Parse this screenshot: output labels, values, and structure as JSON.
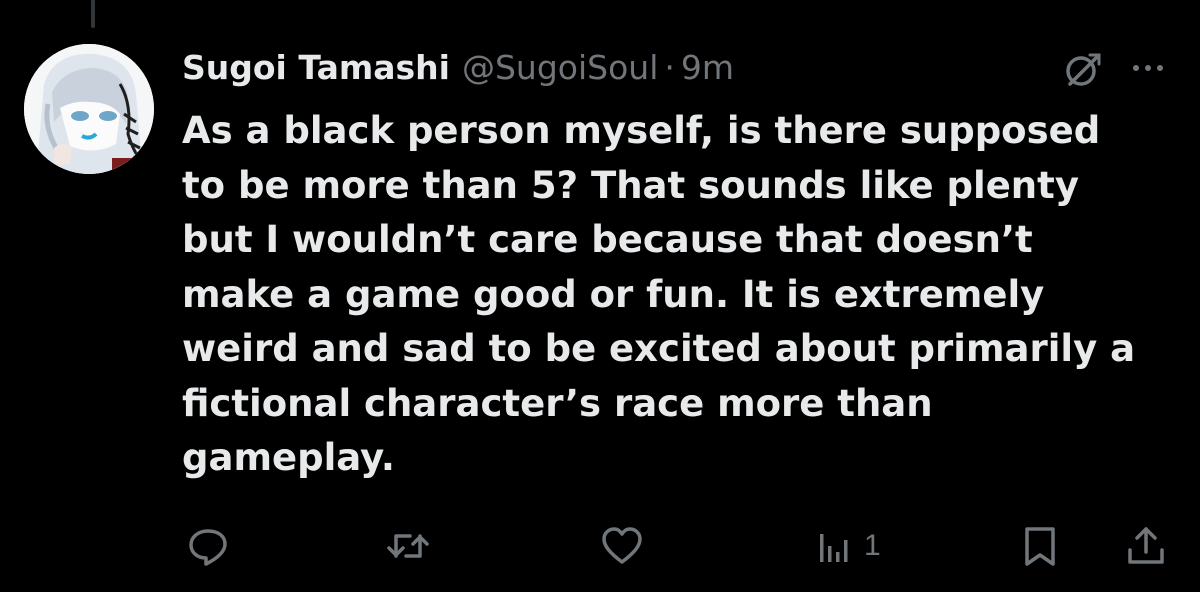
{
  "tweet": {
    "author": {
      "display_name": "Sugoi Tamashi",
      "handle": "@SugoiSoul",
      "avatar_icon": "anime-avatar"
    },
    "separator": "·",
    "timestamp": "9m",
    "text_lines": [
      "As a black person myself, is there supposed",
      "to be more than 5? That sounds like plenty",
      "but I wouldn’t care because that doesn’t",
      "make a game good or fun. It is extremely",
      "weird and sad to be excited about primarily a",
      "fictional character’s race more than",
      "gameplay."
    ],
    "header_icons": [
      "grok-icon",
      "more-icon"
    ],
    "actions": {
      "reply": {
        "icon": "reply-icon"
      },
      "retweet": {
        "icon": "retweet-icon"
      },
      "like": {
        "icon": "like-icon"
      },
      "views": {
        "icon": "views-icon",
        "count": "1"
      },
      "bookmark": {
        "icon": "bookmark-icon"
      },
      "share": {
        "icon": "share-icon"
      }
    }
  },
  "colors": {
    "background": "#000000",
    "primary_text": "#e7e9ea",
    "secondary_text": "#71767b",
    "thread_line": "#333639"
  }
}
